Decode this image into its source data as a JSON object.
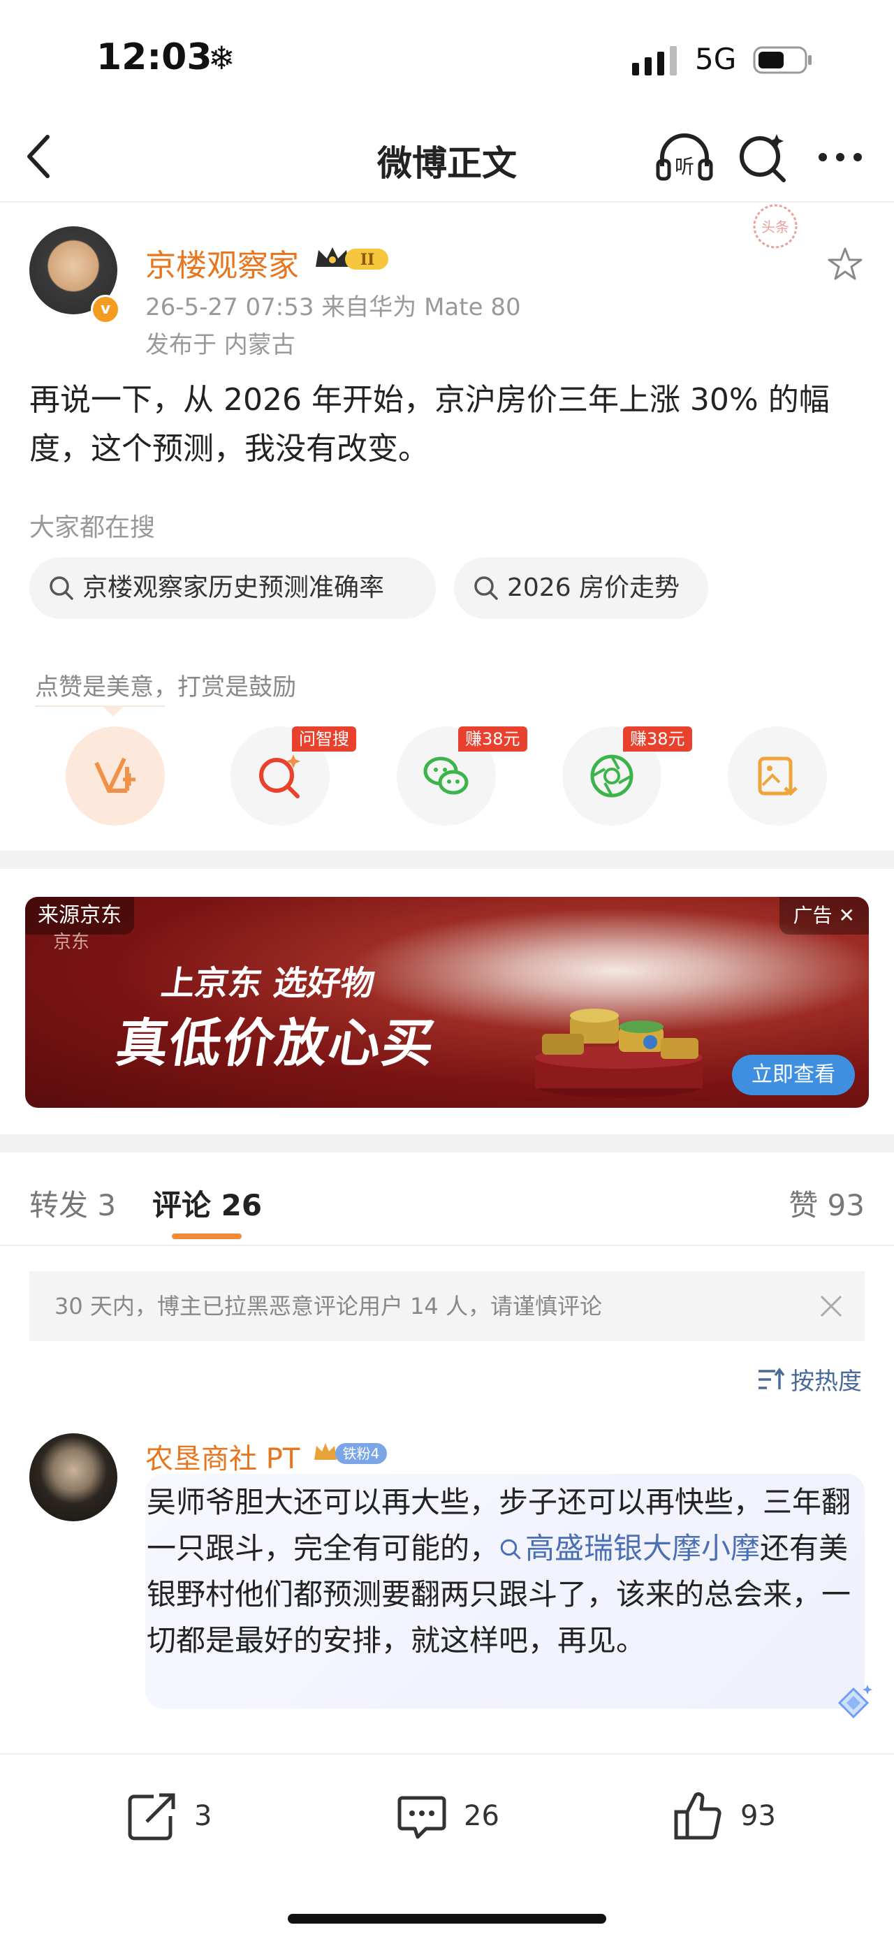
{
  "status_bar": {
    "time": "12:03",
    "weather_icon": "❄",
    "network": "5G"
  },
  "nav": {
    "title": "微博正文",
    "listen_icon_text": "听"
  },
  "post": {
    "author": "京楼观察家",
    "crown_level": "II",
    "timestamp_source": "26-5-27 07:53  来自华为 Mate 80",
    "location": "发布于 内蒙古",
    "stamp_text": "头条",
    "text": "再说一下，从 2026 年开始，京沪房价三年上涨 30% 的幅度，这个预测，我没有改变。"
  },
  "trending": {
    "label": "大家都在搜",
    "chips": [
      "京楼观察家历史预测准确率",
      "2026 房价走势"
    ]
  },
  "actions": {
    "hint": "点赞是美意，打赏是鼓励",
    "tags": [
      "问智搜",
      "赚38元",
      "赚38元"
    ]
  },
  "ad": {
    "source": "来源京东",
    "label": "广告 ✕",
    "brand": "京东",
    "line1": "上京东 选好物",
    "line2": "真低价放心买",
    "cta": "立即查看"
  },
  "tabs": {
    "repost": "转发 3",
    "comments": "评论 26",
    "likes": "赞 93"
  },
  "notice": {
    "text": "30 天内，博主已拉黑恶意评论用户 14 人，请谨慎评论"
  },
  "sort": {
    "label": "按热度"
  },
  "comment": {
    "name": "农垦商社 PT",
    "fan_badge": "铁粉4",
    "text_before": "吴师爷胆大还可以再大些，步子还可以再快些，三年翻一只跟斗，完全有可能的，",
    "link": "高盛瑞银大摩小摩",
    "text_after": "还有美银野村他们都预测要翻两只跟斗了，该来的总会来，一切都是最好的安排，就这样吧，再见。"
  },
  "bottom_bar": {
    "reposts": "3",
    "comments": "26",
    "likes": "93"
  },
  "colors": {
    "accent": "#e8761f",
    "link": "#4a6fb5",
    "cta": "#3f8fe0",
    "tag": "#e8412e"
  }
}
